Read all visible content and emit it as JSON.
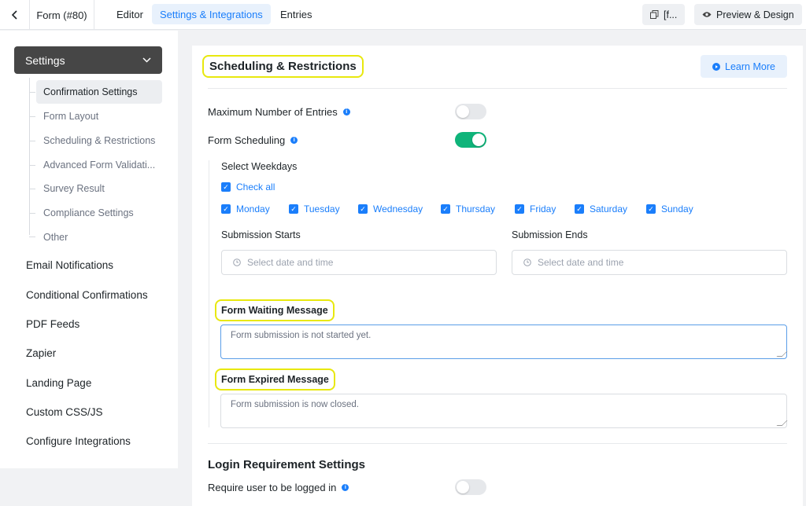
{
  "topbar": {
    "back_icon": "chevron-left-icon",
    "form_id": "Form (#80)",
    "tabs": [
      {
        "label": "Editor",
        "active": false
      },
      {
        "label": "Settings & Integrations",
        "active": true
      },
      {
        "label": "Entries",
        "active": false
      }
    ],
    "shortcode_label": "[f...",
    "preview_label": "Preview & Design"
  },
  "sidebar": {
    "settings_label": "Settings",
    "sub_items": [
      {
        "label": "Confirmation Settings",
        "active": true
      },
      {
        "label": "Form Layout",
        "active": false
      },
      {
        "label": "Scheduling & Restrictions",
        "active": false
      },
      {
        "label": "Advanced Form Validati...",
        "active": false
      },
      {
        "label": "Survey Result",
        "active": false
      },
      {
        "label": "Compliance Settings",
        "active": false
      },
      {
        "label": "Other",
        "active": false
      }
    ],
    "items": [
      "Email Notifications",
      "Conditional Confirmations",
      "PDF Feeds",
      "Zapier",
      "Landing Page",
      "Custom CSS/JS",
      "Configure Integrations"
    ]
  },
  "main": {
    "section_title": "Scheduling & Restrictions",
    "learn_more": "Learn More",
    "max_entries_label": "Maximum Number of Entries",
    "max_entries_enabled": false,
    "form_scheduling_label": "Form Scheduling",
    "form_scheduling_enabled": true,
    "weekdays_label": "Select Weekdays",
    "check_all": "Check all",
    "weekdays": [
      "Monday",
      "Tuesday",
      "Wednesday",
      "Thursday",
      "Friday",
      "Saturday",
      "Sunday"
    ],
    "submission_starts_label": "Submission Starts",
    "submission_ends_label": "Submission Ends",
    "date_placeholder": "Select date and time",
    "waiting_label": "Form Waiting Message",
    "waiting_value": "Form submission is not started yet.",
    "expired_label": "Form Expired Message",
    "expired_value": "Form submission is now closed.",
    "login_title": "Login Requirement Settings",
    "require_login_label": "Require user to be logged in",
    "require_login_enabled": false
  },
  "colors": {
    "accent": "#1a7efb",
    "toggle_on": "#0fb47a",
    "highlight": "#e8e80e"
  }
}
